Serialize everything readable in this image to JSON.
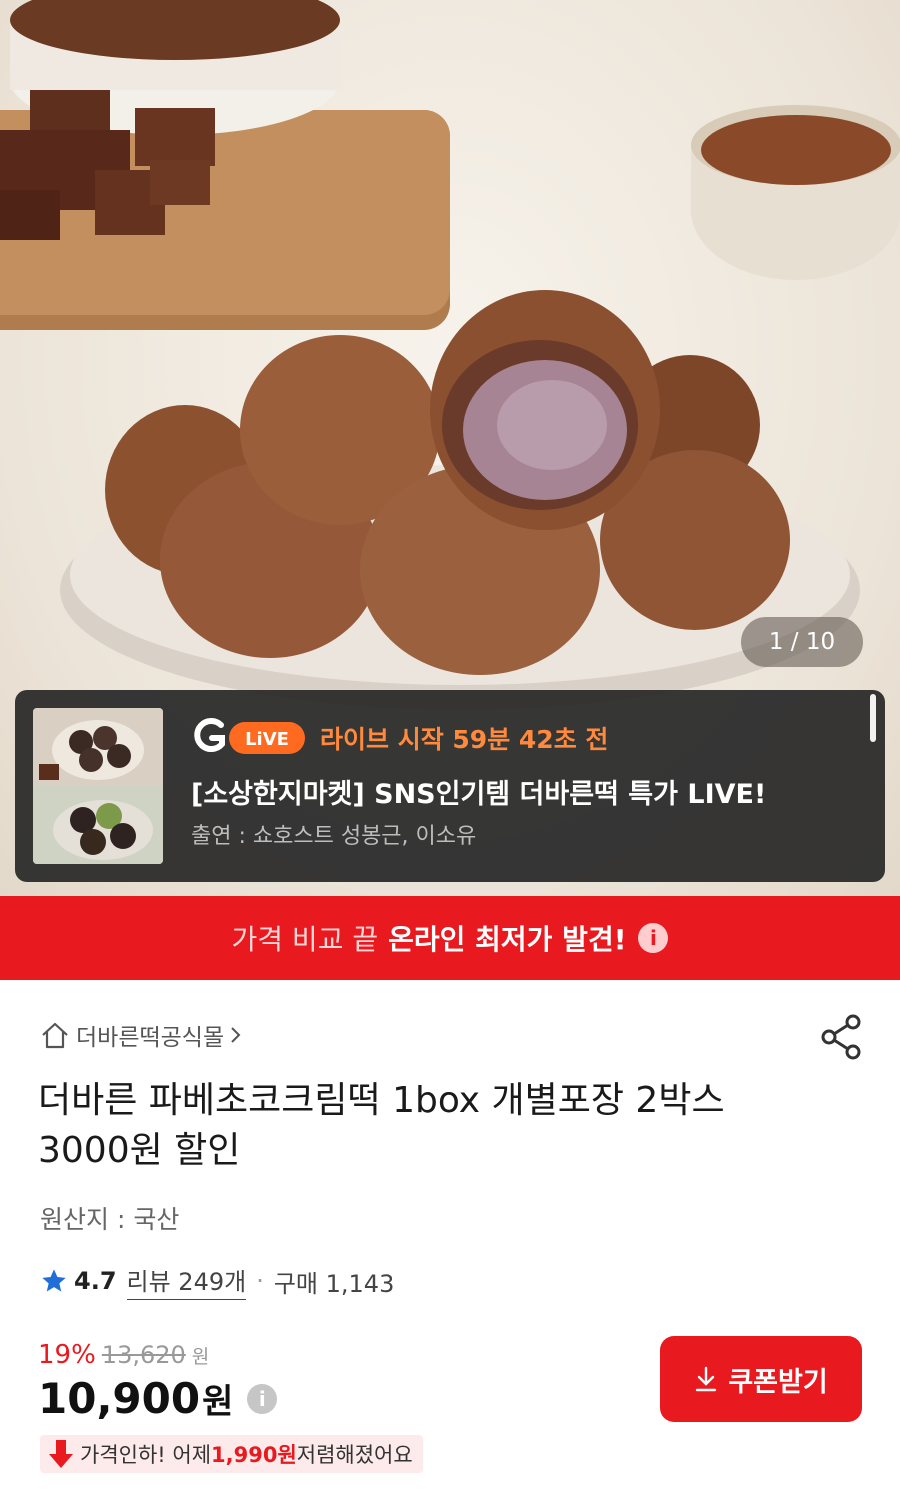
{
  "gallery": {
    "counter": "1 / 10"
  },
  "live": {
    "badge": "LiVE",
    "timer": "라이브 시작 59분 42초 전",
    "title": "[소상한지마켓] SNS인기템 더바른떡 특가 LIVE!",
    "cast": "출연 : 쇼호스트 성봉근, 이소유"
  },
  "banner": {
    "prefix": "가격 비교 끝",
    "emphasis": "온라인 최저가 발견!",
    "info_icon": "i"
  },
  "product": {
    "store": "더바른떡공식몰",
    "name": "더바른 파베초코크림떡 1box 개별포장 2박스 3000원 할인",
    "origin": "원산지 : 국산",
    "rating": "4.7",
    "reviews": "리뷰 249개",
    "purchases": "구매 1,143"
  },
  "price": {
    "discount_pct": "19%",
    "original": "13,620",
    "original_unit": "원",
    "current": "10,900",
    "current_unit": "원",
    "info_icon": "i",
    "coupon_label": "쿠폰받기",
    "drop_prefix": "가격인하! 어제 ",
    "drop_amount": "1,990원",
    "drop_suffix": " 저렴해졌어요"
  },
  "colors": {
    "accent": "#e8191f",
    "live_timer": "#ff8a3d",
    "star": "#1f6fd6"
  },
  "icons": [
    "home-icon",
    "chevron-right-icon",
    "share-icon",
    "star-icon",
    "info-icon",
    "download-icon",
    "down-arrow-icon"
  ]
}
